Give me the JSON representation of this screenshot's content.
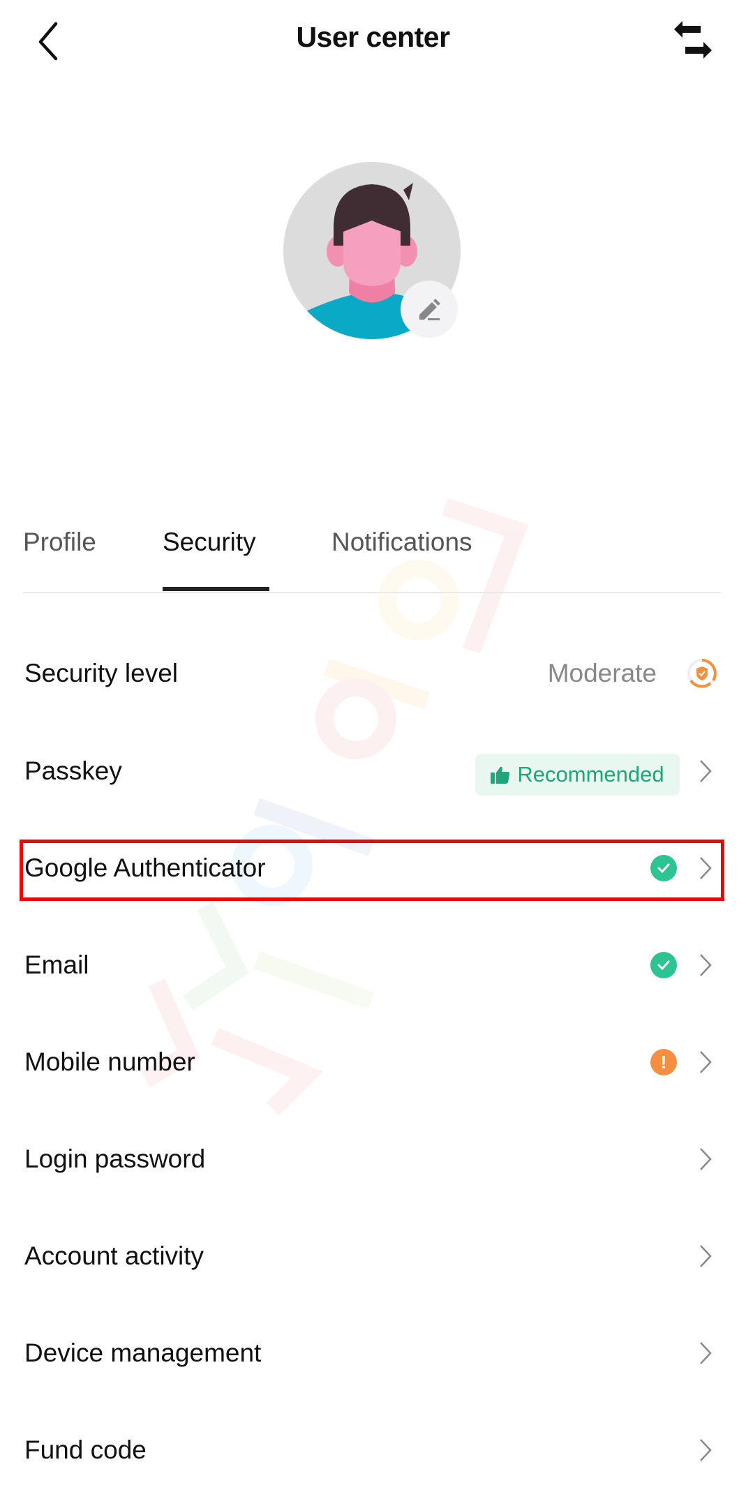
{
  "header": {
    "title": "User center",
    "back_icon": "chevron-left-icon",
    "switch_icon": "swap-arrows-icon"
  },
  "avatar": {
    "edit_icon": "pencil-icon"
  },
  "tabs": [
    {
      "label": "Profile",
      "active": false
    },
    {
      "label": "Security",
      "active": true
    },
    {
      "label": "Notifications",
      "active": false
    }
  ],
  "security": {
    "rows": [
      {
        "label": "Security level",
        "value": "Moderate",
        "icon": "shield-level-icon"
      },
      {
        "label": "Passkey",
        "badge": "Recommended",
        "badge_icon": "thumbs-up-icon"
      },
      {
        "label": "Google Authenticator",
        "status": "enabled",
        "status_icon": "check-circle-icon"
      },
      {
        "label": "Email",
        "status": "enabled",
        "status_icon": "check-circle-icon"
      },
      {
        "label": "Mobile number",
        "status": "warning",
        "status_icon": "exclamation-circle-icon",
        "status_glyph": "!"
      },
      {
        "label": "Login password"
      },
      {
        "label": "Account activity"
      },
      {
        "label": "Device management"
      },
      {
        "label": "Fund code"
      }
    ]
  },
  "colors": {
    "success": "#2ec393",
    "warning": "#f58f3f",
    "badge_text": "#1fa57a",
    "badge_bg": "#e8f8f1",
    "highlight": "#e50b0b",
    "level": "#f0913e"
  }
}
